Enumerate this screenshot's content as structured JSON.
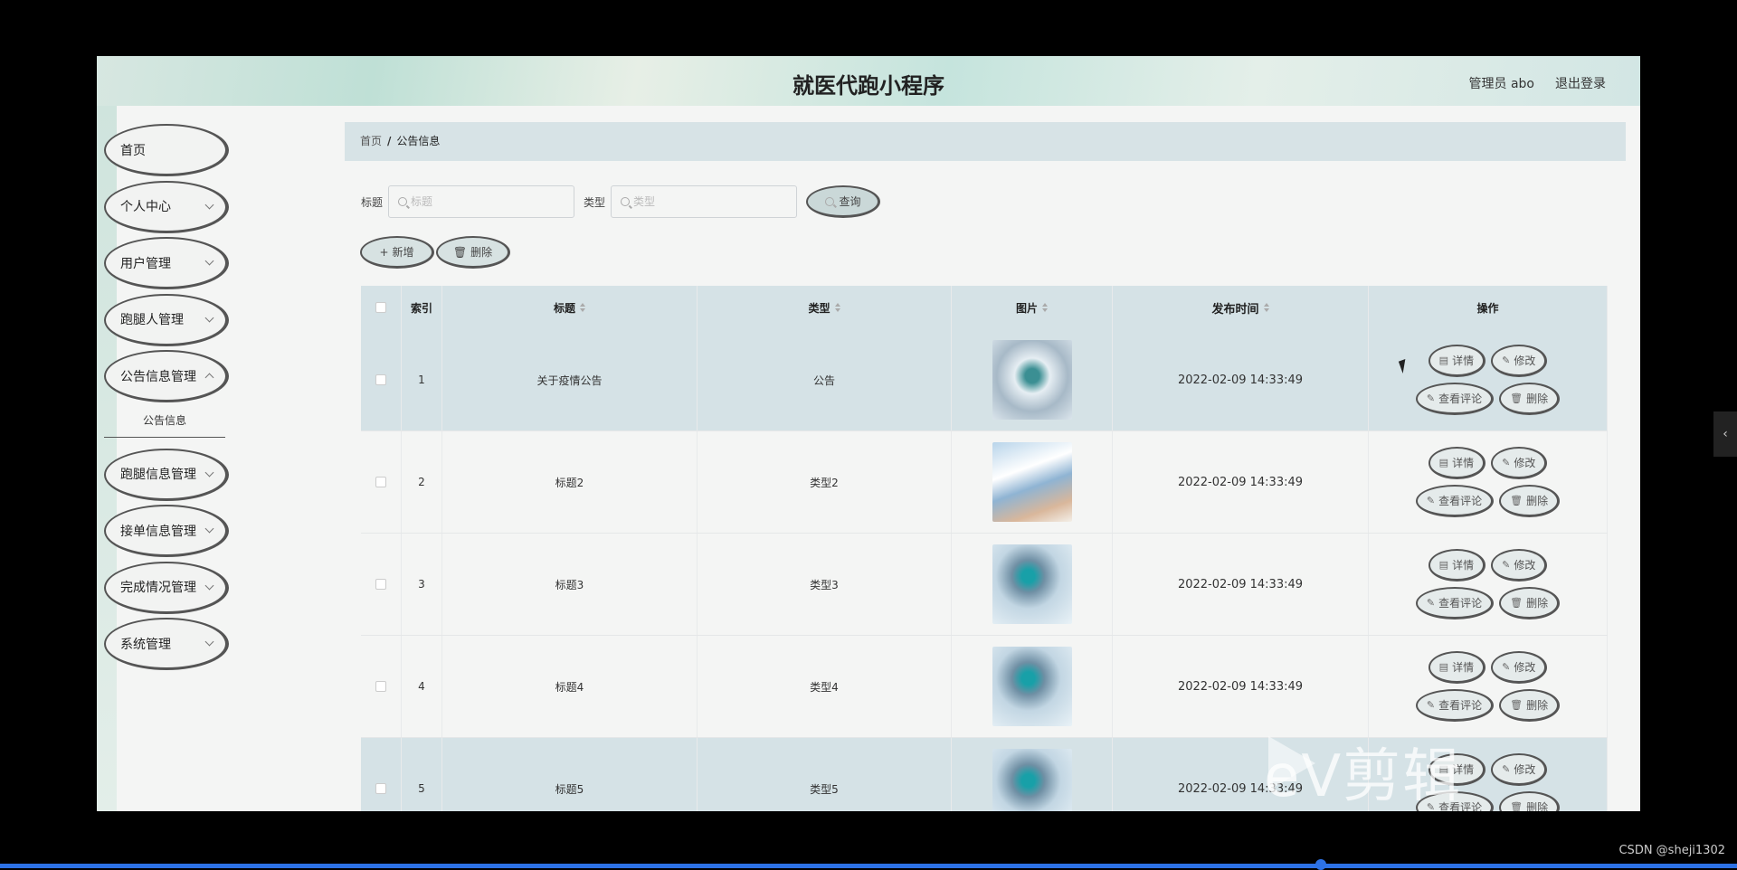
{
  "header": {
    "title": "就医代跑小程序",
    "user": "管理员 abo",
    "logout": "退出登录"
  },
  "sidebar": {
    "items": [
      {
        "label": "首页"
      },
      {
        "label": "个人中心"
      },
      {
        "label": "用户管理"
      },
      {
        "label": "跑腿人管理"
      },
      {
        "label": "公告信息管理"
      },
      {
        "label": "跑腿信息管理"
      },
      {
        "label": "接单信息管理"
      },
      {
        "label": "完成情况管理"
      },
      {
        "label": "系统管理"
      }
    ],
    "submenu": "公告信息"
  },
  "breadcrumb": {
    "home": "首页",
    "sep": "/",
    "current": "公告信息"
  },
  "search": {
    "title_label": "标题",
    "title_placeholder": "标题",
    "type_label": "类型",
    "type_placeholder": "类型",
    "button": "查询"
  },
  "actions": {
    "add": "新增",
    "delete": "删除"
  },
  "table": {
    "headers": {
      "index": "索引",
      "title": "标题",
      "type": "类型",
      "image": "图片",
      "time": "发布时间",
      "ops": "操作"
    },
    "ops_labels": {
      "detail": "详情",
      "edit": "修改",
      "comments": "查看评论",
      "delete": "删除"
    },
    "rows": [
      {
        "index": "1",
        "title": "关于疫情公告",
        "type": "公告",
        "time": "2022-02-09 14:33:49"
      },
      {
        "index": "2",
        "title": "标题2",
        "type": "类型2",
        "time": "2022-02-09 14:33:49"
      },
      {
        "index": "3",
        "title": "标题3",
        "type": "类型3",
        "time": "2022-02-09 14:33:49"
      },
      {
        "index": "4",
        "title": "标题4",
        "type": "类型4",
        "time": "2022-02-09 14:33:49"
      },
      {
        "index": "5",
        "title": "标题5",
        "type": "类型5",
        "time": "2022-02-09 14:33:49"
      }
    ]
  },
  "overlay": {
    "watermark": "eV剪辑",
    "credit": "CSDN @sheji1302",
    "side_tab": "‹"
  }
}
